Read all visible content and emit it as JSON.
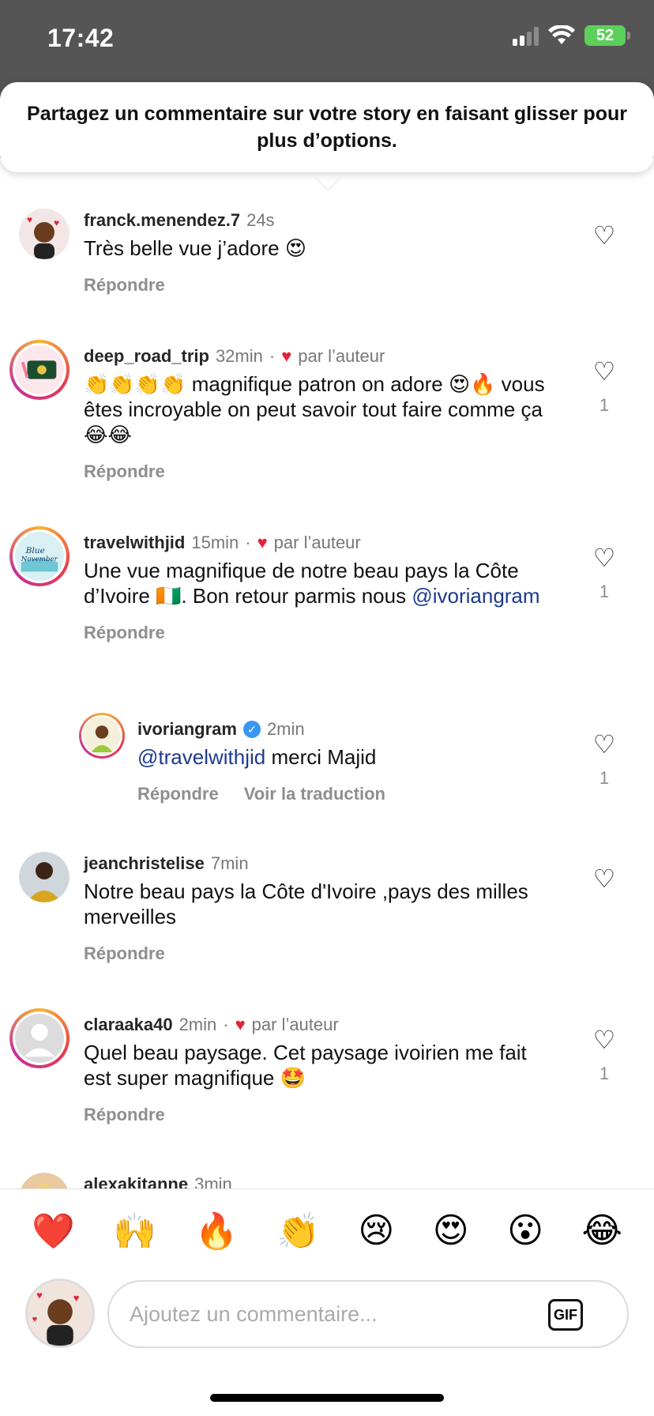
{
  "status_bar": {
    "time": "17:42",
    "battery": "52"
  },
  "tooltip": {
    "text": "Partagez un commentaire sur votre story en faisant glisser pour plus d’options."
  },
  "comments": [
    {
      "username": "franck.menendez.7",
      "time": "24s",
      "text": "Très belle vue j’adore 😍",
      "reply_label": "Répondre",
      "likes": ""
    },
    {
      "username": "deep_road_trip",
      "time": "32min",
      "liked_by_author": "par l’auteur",
      "text": "👏👏👏👏 magnifique patron on adore 😍🔥 vous êtes incroyable on peut savoir tout faire comme ça 😂😂",
      "reply_label": "Répondre",
      "likes": "1"
    },
    {
      "username": "travelwithjid",
      "time": "15min",
      "liked_by_author": "par l’auteur",
      "text_before": "Une vue magnifique de notre beau pays la Côte d’Ivoire 🇨🇮. Bon retour parmis nous ",
      "mention": "@ivoriangram",
      "reply_label": "Répondre",
      "likes": "1"
    },
    {
      "username": "ivoriangram",
      "time": "2min",
      "mention": "@travelwithjid",
      "text_after": " merci Majid",
      "reply_label": "Répondre",
      "translate_label": "Voir la traduction",
      "likes": "1"
    },
    {
      "username": "jeanchristelise",
      "time": "7min",
      "text": "Notre beau pays la Côte d'Ivoire ,pays des milles merveilles",
      "reply_label": "Répondre",
      "likes": ""
    },
    {
      "username": "claraaka40",
      "time": "2min",
      "liked_by_author": "par l’auteur",
      "text": "Quel beau paysage. Cet paysage ivoirien me fait est super magnifique 🤩",
      "reply_label": "Répondre",
      "likes": "1"
    },
    {
      "username": "alexakitanne",
      "time": "3min"
    }
  ],
  "quick_reactions": [
    "❤️",
    "🙌",
    "🔥",
    "👏",
    "😢",
    "😍",
    "😮",
    "😂"
  ],
  "composer": {
    "placeholder": "Ajoutez un commentaire...",
    "gif_label": "GIF"
  },
  "colors": {
    "status_bg": "#555555",
    "mention": "#1d3a8f",
    "heart_red": "#e0243a",
    "battery": "#5dcf5b",
    "verified": "#3897f0"
  },
  "icons": {
    "heart_outline": "♡",
    "heart_filled": "♥",
    "wifi": "wifi-icon",
    "signal": "signal-icon"
  }
}
